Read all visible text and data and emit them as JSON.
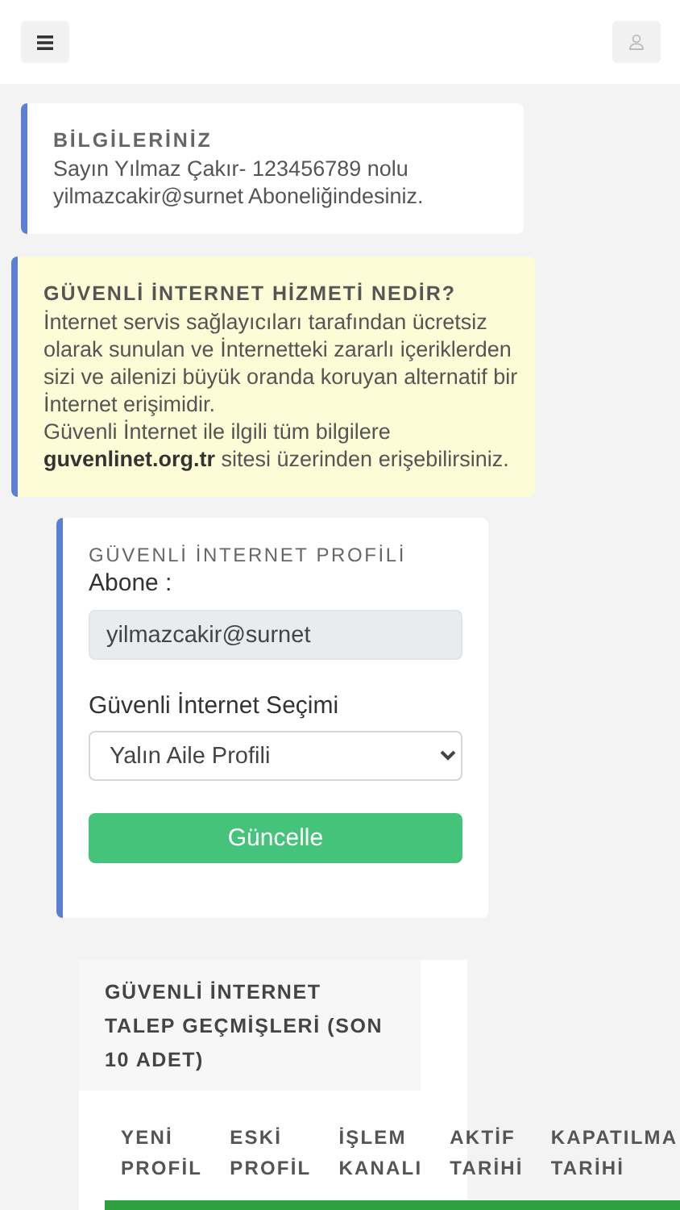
{
  "info_card": {
    "title": "BİLGİLERİNİZ",
    "text": "Sayın Yılmaz Çakır- 123456789 nolu yilmazcakir@surnet Aboneliğindesiniz."
  },
  "notice_card": {
    "title": "GÜVENLİ İNTERNET HİZMETİ NEDİR?",
    "lines": [
      "İnternet servis sağlayıcıları tarafından ücretsiz olarak sunulan ve İnternetteki zararlı içeriklerden sizi ve ailenizi büyük oranda koruyan alternatif bir İnternet erişimidir.",
      "Güvenli İnternet ile ilgili tüm bilgilere **guvenlinet.org.tr** sitesi üzerinden erişebilirsiniz."
    ]
  },
  "profile_card": {
    "title": "GÜVENLİ İNTERNET PROFİLİ",
    "subscriber_label": "Abone :",
    "subscriber_value": "yilmazcakir@surnet",
    "selection_label": "Güvenli İnternet Seçimi",
    "selection_value": "Yalın Aile Profili",
    "button": "Güncelle"
  },
  "history_card": {
    "title": "GÜVENLİ İNTERNET TALEP GEÇMİŞLERİ (SON 10 ADET)",
    "columns": [
      [
        "YENİ",
        "PROFİL"
      ],
      [
        "ESKİ",
        "PROFİL"
      ],
      [
        "İŞLEM",
        "KANALI"
      ],
      [
        "AKTİF",
        "TARİHİ"
      ],
      [
        "KAPATILMA",
        "TARİHİ"
      ]
    ]
  }
}
